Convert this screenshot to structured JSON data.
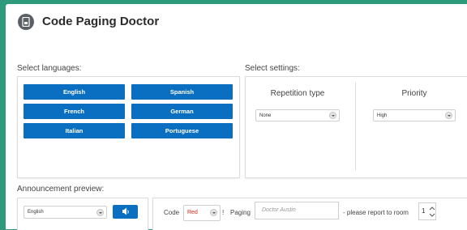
{
  "header": {
    "title": "Code Paging Doctor",
    "icon": "document-icon"
  },
  "languages": {
    "label": "Select languages:",
    "buttons": [
      "English",
      "Spanish",
      "French",
      "German",
      "Italian",
      "Portuguese"
    ],
    "button_color": "#0b6fc1"
  },
  "settings": {
    "label": "Select settings:",
    "repetition": {
      "heading": "Repetition type",
      "value": "None"
    },
    "priority": {
      "heading": "Priority",
      "value": "High"
    }
  },
  "preview": {
    "label": "Announcement preview:",
    "language_value": "English",
    "code_label": "Code",
    "code_value": "Red",
    "code_value_color": "#d9291c",
    "separator": "!",
    "paging_label": "Paging",
    "paging_placeholder": "Doctor Austin",
    "report_label": "- please report to room",
    "room_value": "1"
  }
}
